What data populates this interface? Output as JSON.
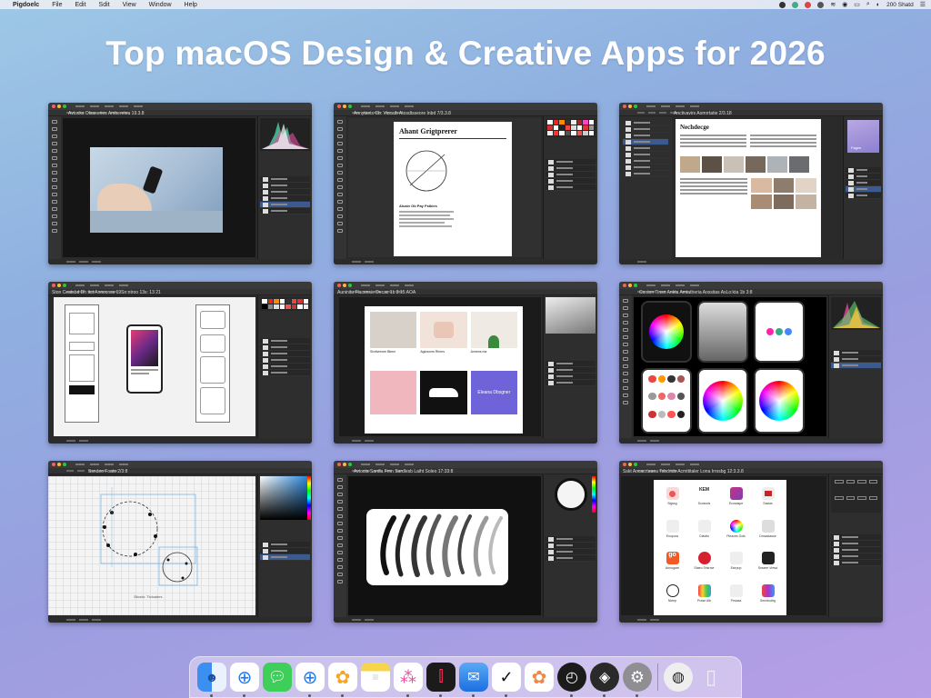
{
  "menubar": {
    "app_name": "Pigdoelc",
    "items": [
      "File",
      "Edit",
      "Sdit",
      "View",
      "Window",
      "Help"
    ],
    "clock": "200 Shatd"
  },
  "page": {
    "title": "Top macOS Design & Creative Apps for 2026"
  },
  "windows": [
    {
      "id": "w1",
      "doc_title": "Avtocks Olsaeeries Amberetea 19.3.8",
      "kind": "photo-editor"
    },
    {
      "id": "w2",
      "doc_title": "Annytavts Cb: Viccatb Atosdtsseore Inbd 7/3.3.8",
      "kind": "layout-doc",
      "doc_heading": "Ahant Grigtprerer",
      "caption": "Alcain Ob Pay Fstkies"
    },
    {
      "id": "w3",
      "doc_title": "Anctivavirs Aomrrtatie 2/3.18",
      "kind": "magazine",
      "doc_heading": "Nechdecge",
      "thumb_label": "Fages"
    },
    {
      "id": "w4",
      "doc_title": "Ston Ceatsbd Dh ttct Annconss 19Sn:ntroo 13s: 13 21",
      "kind": "wireframe"
    },
    {
      "id": "w5",
      "doc_title": "Auninitu Flaconsie Decac 1b 3:15 AOA",
      "kind": "product-grid",
      "cells": [
        "Sivdivrecen Bleen",
        "Agiosonrs Rirrins",
        "Annens ma",
        "Eleana Dbsgner"
      ]
    },
    {
      "id": "w6",
      "doc_title": "Conton Tinsn Ankta Amtatheria Aossitas AsLo:kta 1b 3:8",
      "kind": "color-phones"
    },
    {
      "id": "w7",
      "doc_title": "Ssndeo Foats 2/3:8",
      "kind": "vector",
      "caption": "Sitcsto: Ttvloaiers"
    },
    {
      "id": "w8",
      "doc_title": "Avtocta Sardla Fmn Sardlesb Laiht Soleo 17:33:8",
      "kind": "brushes"
    },
    {
      "id": "w9",
      "doc_title": "Sskt Aocacrtaaea Tsbdrtds Acmttitaler Lona Irrosbg 12:3.3.8",
      "kind": "app-grid",
      "apps": [
        "Sigssg",
        "Scosuds",
        "Ecosaspe",
        "Sasias",
        "Enopocs",
        "Clastto",
        "Pieaces Gols",
        "Dmsadasse",
        "Annogare",
        "Staeo Srisrrwr",
        "Esirpup",
        "Sreaee Vresa",
        "Nleep",
        "Prase Alb",
        "Pesasa",
        "Sensbuttrg"
      ]
    }
  ],
  "dock": {
    "icons": [
      "finder-icon",
      "safari-icon",
      "messages-icon",
      "safari-alt-icon",
      "photos-icon",
      "notes-icon",
      "launchpad-icon",
      "stocks-icon",
      "mail-icon",
      "nike-icon",
      "photos-alt-icon",
      "clock-icon",
      "compass-icon",
      "settings-icon",
      "speech-icon",
      "trash-icon"
    ]
  }
}
